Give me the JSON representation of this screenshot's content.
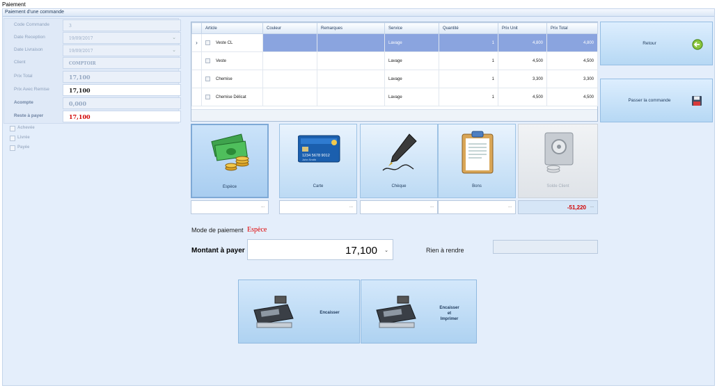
{
  "window": {
    "title": "Paiement"
  },
  "group": {
    "header": "Paiement d'une commande"
  },
  "form": {
    "code_commande": {
      "label": "Code Commande",
      "value": "3"
    },
    "date_reception": {
      "label": "Date Reception",
      "value": "19/09/2017"
    },
    "date_livraison": {
      "label": "Date Livraison",
      "value": "19/09/2017"
    },
    "client": {
      "label": "Client",
      "value": "COMPTOIR"
    },
    "prix_total": {
      "label": "Prix Total",
      "value": "17,100"
    },
    "prix_remise": {
      "label": "Prix Avec Remise",
      "value": "17,100"
    },
    "acompte": {
      "label": "Acompte",
      "value": "0,000"
    },
    "reste": {
      "label": "Reste à payer",
      "value": "17,100"
    },
    "checks": [
      "Achevée",
      "Livrée",
      "Payée"
    ]
  },
  "grid": {
    "columns": [
      "Article",
      "Couleur",
      "Remarques",
      "Service",
      "Quantité",
      "Prix Unit",
      "Prix Total"
    ],
    "rows": [
      {
        "article": "Veste CL",
        "couleur": "",
        "remarques": "",
        "service": "Lavage",
        "quantite": "1",
        "prix_unit": "4,800",
        "prix_total": "4,800"
      },
      {
        "article": "Veste",
        "couleur": "",
        "remarques": "",
        "service": "Lavage",
        "quantite": "1",
        "prix_unit": "4,500",
        "prix_total": "4,500"
      },
      {
        "article": "Chemise",
        "couleur": "",
        "remarques": "",
        "service": "Lavage",
        "quantite": "1",
        "prix_unit": "3,300",
        "prix_total": "3,300"
      },
      {
        "article": "Chemise Délicat",
        "couleur": "",
        "remarques": "",
        "service": "Lavage",
        "quantite": "1",
        "prix_unit": "4,500",
        "prix_total": "4,500"
      }
    ],
    "row_indicator": "›"
  },
  "buttons": {
    "retour": "Retour",
    "passer": "Passer la commande",
    "encaisser": "Encaisser",
    "encaisser_imprimer": [
      "Encaisser",
      "et",
      "Imprimer"
    ]
  },
  "payment_modes": {
    "espece": "Espèce",
    "carte": "Carte",
    "cheque": "Chèque",
    "bons": "Bons",
    "solde": "Solde Client",
    "solde_value": "-51,220",
    "dots": "..."
  },
  "card_text": {
    "number": "1234 5678 9012",
    "name": "John Smith"
  },
  "mode_paiement": {
    "label": "Mode de paiement",
    "value": "Espèce"
  },
  "montant": {
    "label": "Montant à payer",
    "value": "17,100"
  },
  "rendre": {
    "label": "Rien à rendre",
    "value": ""
  },
  "colors": {
    "accent": "#8aa4df",
    "red": "#d00000",
    "panel": "#e4eefb"
  }
}
